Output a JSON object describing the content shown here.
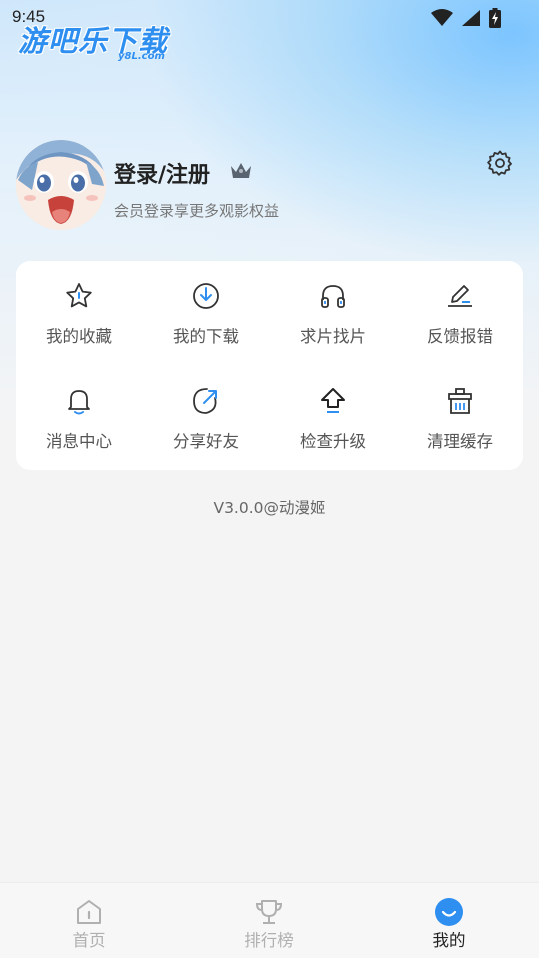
{
  "status_bar": {
    "time": "9:45"
  },
  "brand": {
    "name": "游吧乐下载",
    "sub": "y8L.com"
  },
  "profile": {
    "username": "登录/注册",
    "subtitle": "会员登录享更多观影权益"
  },
  "menu": {
    "items": [
      {
        "label": "我的收藏",
        "icon": "star-icon"
      },
      {
        "label": "我的下载",
        "icon": "download-icon"
      },
      {
        "label": "求片找片",
        "icon": "headphones-icon"
      },
      {
        "label": "反馈报错",
        "icon": "edit-icon"
      },
      {
        "label": "消息中心",
        "icon": "bell-icon"
      },
      {
        "label": "分享好友",
        "icon": "share-icon"
      },
      {
        "label": "检查升级",
        "icon": "upgrade-arrow-icon"
      },
      {
        "label": "清理缓存",
        "icon": "trash-icon"
      }
    ]
  },
  "version": "V3.0.0@动漫姬",
  "tabbar": {
    "tabs": [
      {
        "label": "首页",
        "icon": "home-icon"
      },
      {
        "label": "排行榜",
        "icon": "trophy-icon"
      },
      {
        "label": "我的",
        "icon": "profile-face-icon"
      }
    ],
    "active_index": 2
  },
  "colors": {
    "accent": "#2f8ff0",
    "background": "#f4f4f5",
    "card": "#ffffff"
  }
}
